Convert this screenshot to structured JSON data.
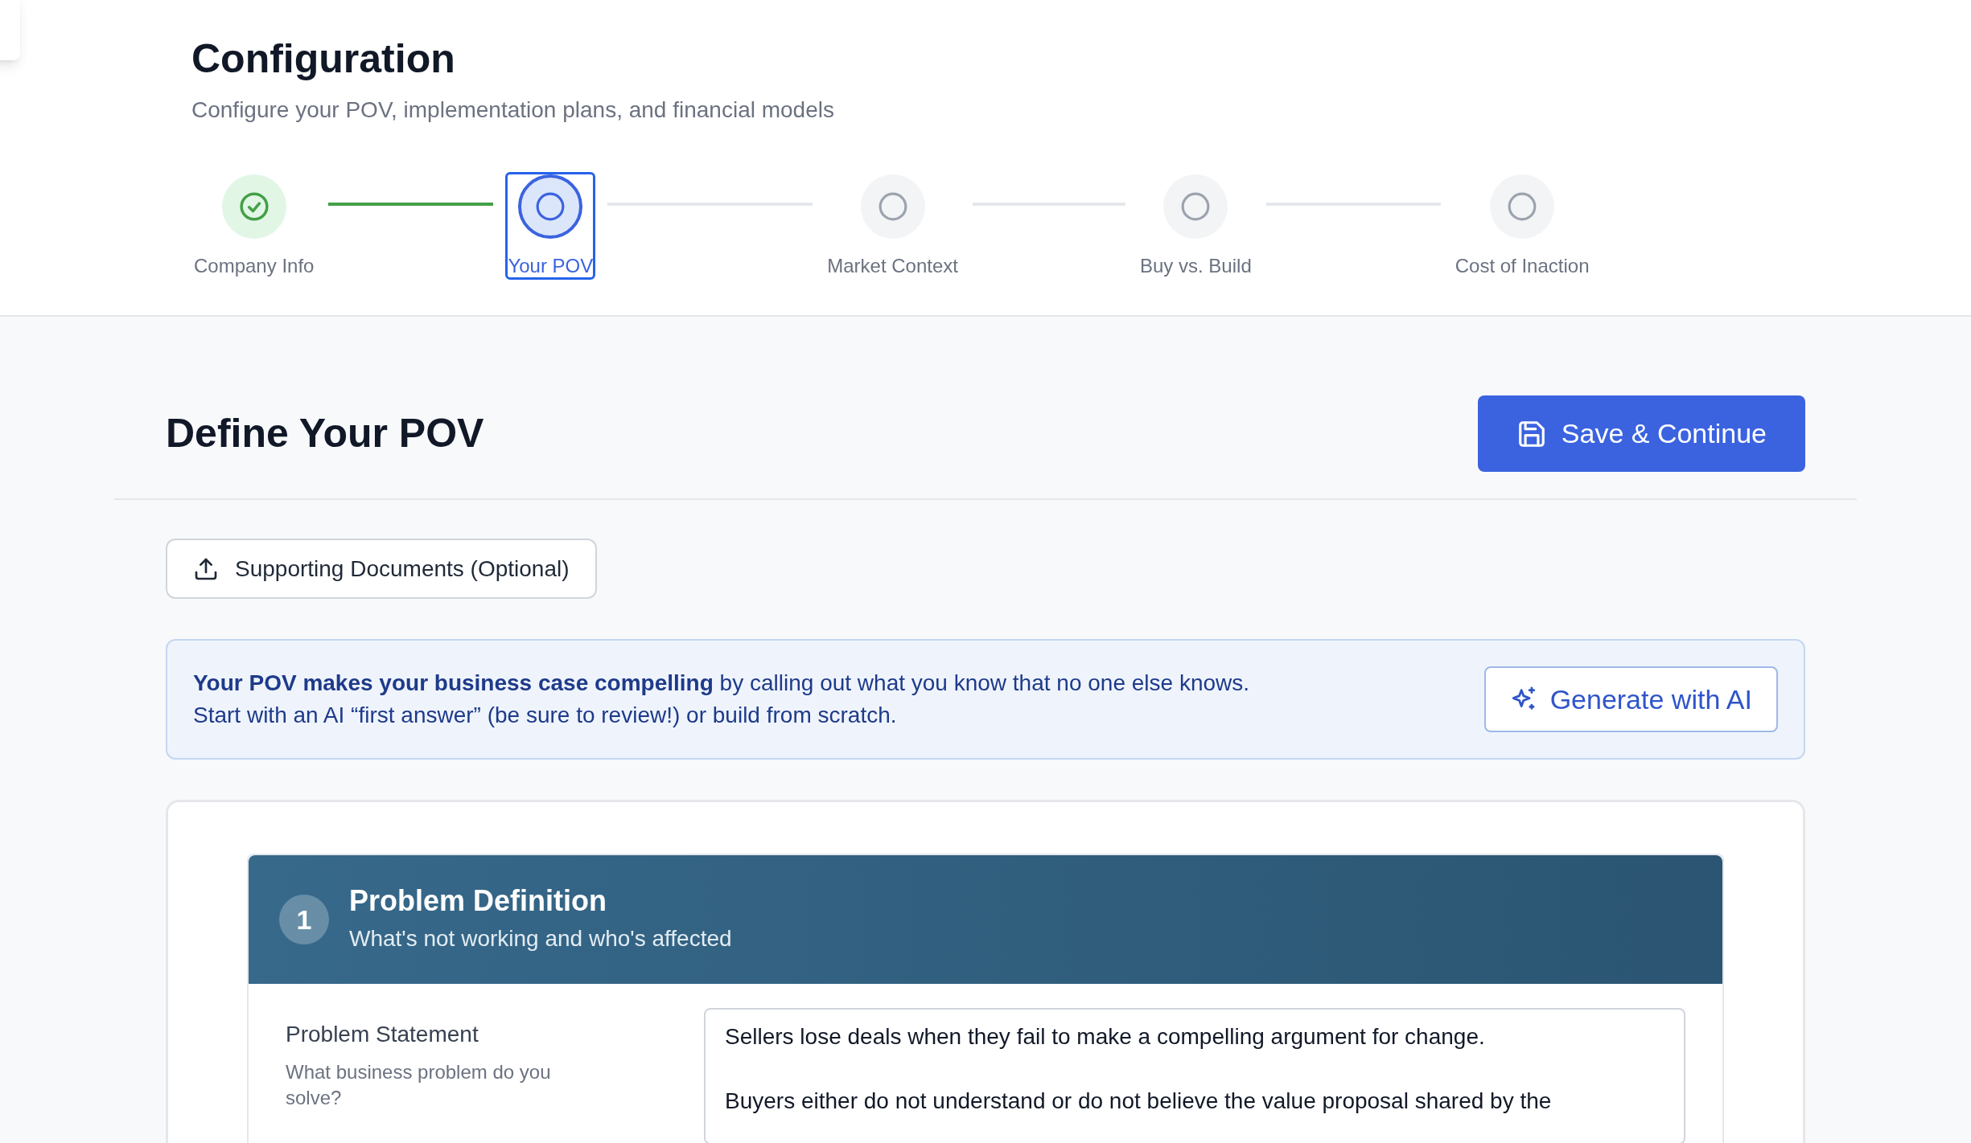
{
  "header": {
    "title": "Configuration",
    "subtitle": "Configure your POV, implementation plans, and financial models"
  },
  "steps": [
    {
      "label": "Company Info",
      "kind": "complete",
      "selected": false
    },
    {
      "label": "Your POV",
      "kind": "current",
      "selected": true
    },
    {
      "label": "Market Context",
      "kind": "upcoming",
      "selected": false
    },
    {
      "label": "Buy vs. Build",
      "kind": "upcoming",
      "selected": false
    },
    {
      "label": "Cost of Inaction",
      "kind": "upcoming",
      "selected": false
    }
  ],
  "page": {
    "title": "Define Your POV",
    "save_button": "Save & Continue",
    "upload_button": "Supporting Documents (Optional)"
  },
  "info": {
    "lines": [
      "**Your POV makes your business case compelling** by calling out what you know that no one else knows.",
      "Start with an AI “first answer” (be sure to review!) or build from scratch."
    ],
    "button": "Generate with AI"
  },
  "section": {
    "number": "1",
    "title": "Problem Definition",
    "subtitle": "What's not working and who's affected",
    "fields": [
      {
        "label": "Problem Statement",
        "hint": "What business problem do you solve?",
        "value": "Sellers lose deals when they fail to make a compelling argument for change.\n\nBuyers either do not understand or do not believe the value proposal shared by the"
      }
    ]
  }
}
